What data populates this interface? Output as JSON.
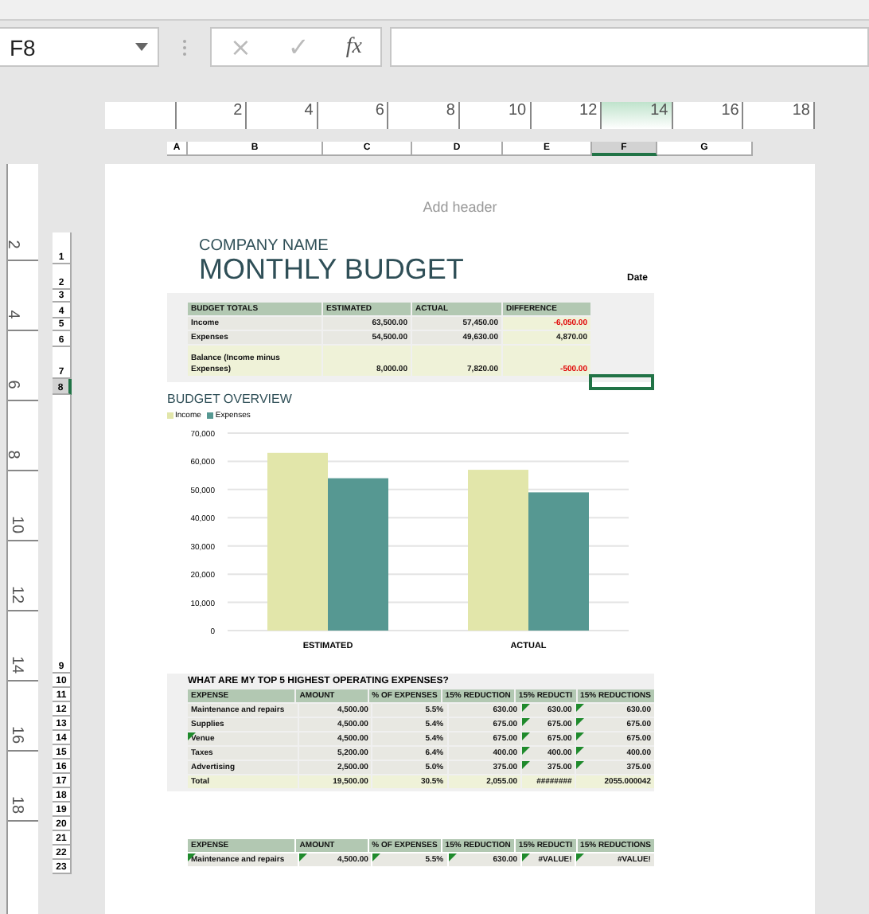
{
  "name_box": {
    "value": "F8"
  },
  "formula_bar": {
    "cancel": "×",
    "enter": "✓",
    "function": "fx"
  },
  "ruler": {
    "marks": [
      {
        "label": "2",
        "selected": false
      },
      {
        "label": "4",
        "selected": false
      },
      {
        "label": "6",
        "selected": false
      },
      {
        "label": "8",
        "selected": false
      },
      {
        "label": "10",
        "selected": false
      },
      {
        "label": "12",
        "selected": false
      },
      {
        "label": "14",
        "selected": true
      },
      {
        "label": "16",
        "selected": false
      },
      {
        "label": "18",
        "selected": false
      }
    ]
  },
  "columns": [
    {
      "label": "A",
      "selected": false
    },
    {
      "label": "B",
      "selected": false
    },
    {
      "label": "C",
      "selected": false
    },
    {
      "label": "D",
      "selected": false
    },
    {
      "label": "E",
      "selected": false
    },
    {
      "label": "F",
      "selected": true
    },
    {
      "label": "G",
      "selected": false
    }
  ],
  "vertical_ruler": {
    "marks": [
      "2",
      "4",
      "6",
      "8",
      "10",
      "12",
      "14",
      "16",
      "18"
    ]
  },
  "rows": [
    {
      "label": "1",
      "selected": false
    },
    {
      "label": "2",
      "selected": false
    },
    {
      "label": "3",
      "selected": false
    },
    {
      "label": "4",
      "selected": false
    },
    {
      "label": "5",
      "selected": false
    },
    {
      "label": "6",
      "selected": false
    },
    {
      "label": "7",
      "selected": false
    },
    {
      "label": "8",
      "selected": true
    },
    {
      "label": "9",
      "selected": false
    },
    {
      "label": "10",
      "selected": false
    },
    {
      "label": "11",
      "selected": false
    },
    {
      "label": "12",
      "selected": false
    },
    {
      "label": "13",
      "selected": false
    },
    {
      "label": "14",
      "selected": false
    },
    {
      "label": "15",
      "selected": false
    },
    {
      "label": "16",
      "selected": false
    },
    {
      "label": "17",
      "selected": false
    },
    {
      "label": "18",
      "selected": false
    },
    {
      "label": "19",
      "selected": false
    },
    {
      "label": "20",
      "selected": false
    },
    {
      "label": "21",
      "selected": false
    },
    {
      "label": "22",
      "selected": false
    },
    {
      "label": "23",
      "selected": false
    }
  ],
  "page": {
    "header_placeholder": "Add header",
    "company": "COMPANY NAME",
    "title": "MONTHLY BUDGET",
    "date_label": "Date"
  },
  "budget_totals": {
    "columns": [
      "BUDGET TOTALS",
      "ESTIMATED",
      "ACTUAL",
      "DIFFERENCE"
    ],
    "rows": [
      {
        "kind": "body",
        "cells": [
          "Income",
          "63,500.00",
          "57,450.00",
          "-6,050.00"
        ],
        "negative": true
      },
      {
        "kind": "body",
        "cells": [
          "Expenses",
          "54,500.00",
          "49,630.00",
          "4,870.00"
        ],
        "negative": false
      },
      {
        "kind": "total",
        "cells": [
          "Balance (Income minus Expenses)",
          "8,000.00",
          "7,820.00",
          "-500.00"
        ],
        "negative": true
      }
    ]
  },
  "chart": {
    "title": "BUDGET OVERVIEW",
    "chart_data": {
      "type": "bar",
      "categories": [
        "ESTIMATED",
        "ACTUAL"
      ],
      "series": [
        {
          "name": "Income",
          "color": "#e2e6aa",
          "values": [
            63000,
            57000
          ]
        },
        {
          "name": "Expenses",
          "color": "#569892",
          "values": [
            54000,
            49000
          ]
        }
      ],
      "grid": true,
      "ylim": [
        0,
        70000
      ],
      "yticks": [
        {
          "value": 0,
          "label": "0"
        },
        {
          "value": 10000,
          "label": "10,000"
        },
        {
          "value": 20000,
          "label": "20,000"
        },
        {
          "value": 30000,
          "label": "30,000"
        },
        {
          "value": 40000,
          "label": "40,000"
        },
        {
          "value": 50000,
          "label": "50,000"
        },
        {
          "value": 60000,
          "label": "60,000"
        },
        {
          "value": 70000,
          "label": "70,000"
        }
      ]
    }
  },
  "expenses": {
    "question": "WHAT ARE MY TOP 5 HIGHEST OPERATING EXPENSES?",
    "columns": [
      "EXPENSE",
      "AMOUNT",
      "% OF EXPENSES",
      "15% REDUCTION",
      "15% REDUCTI",
      "15% REDUCTIONS"
    ],
    "rows": [
      {
        "kind": "body",
        "cells": [
          "Maintenance and repairs",
          "4,500.00",
          "5.5%",
          "630.00",
          "630.00",
          "630.00"
        ],
        "flags": [
          false,
          false,
          false,
          false,
          true,
          true
        ]
      },
      {
        "kind": "body",
        "cells": [
          "Supplies",
          "4,500.00",
          "5.4%",
          "675.00",
          "675.00",
          "675.00"
        ],
        "flags": [
          false,
          false,
          false,
          false,
          true,
          true
        ]
      },
      {
        "kind": "body",
        "cells": [
          "Venue",
          "4,500.00",
          "5.4%",
          "675.00",
          "675.00",
          "675.00"
        ],
        "flags": [
          true,
          false,
          false,
          false,
          true,
          true
        ]
      },
      {
        "kind": "body",
        "cells": [
          "Taxes",
          "5,200.00",
          "6.4%",
          "400.00",
          "400.00",
          "400.00"
        ],
        "flags": [
          false,
          false,
          false,
          false,
          true,
          true
        ]
      },
      {
        "kind": "body",
        "cells": [
          "Advertising",
          "2,500.00",
          "5.0%",
          "375.00",
          "375.00",
          "375.00"
        ],
        "flags": [
          false,
          false,
          false,
          false,
          true,
          true
        ]
      },
      {
        "kind": "total",
        "cells": [
          "Total",
          "19,500.00",
          "30.5%",
          "2,055.00",
          "########",
          "2055.000042"
        ],
        "flags": [
          false,
          false,
          false,
          false,
          false,
          false
        ]
      }
    ]
  },
  "expenses_copy": {
    "columns": [
      "EXPENSE",
      "AMOUNT",
      "% OF EXPENSES",
      "15% REDUCTION",
      "15% REDUCTI",
      "15% REDUCTIONS"
    ],
    "rows": [
      {
        "kind": "body",
        "cells": [
          "Maintenance and repairs",
          "4,500.00",
          "5.5%",
          "630.00",
          "#VALUE!",
          "#VALUE!"
        ],
        "flags": [
          true,
          true,
          true,
          true,
          true,
          true
        ]
      }
    ]
  }
}
